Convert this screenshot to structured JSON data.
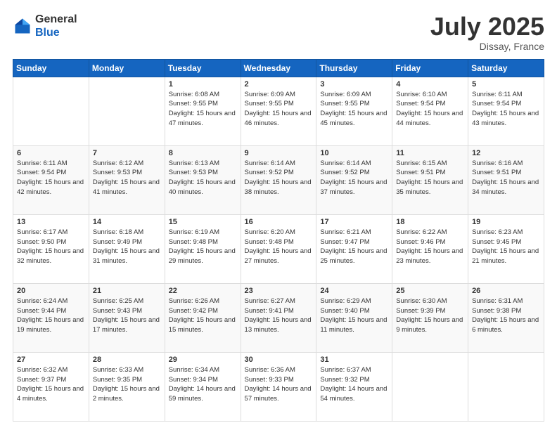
{
  "header": {
    "logo_general": "General",
    "logo_blue": "Blue",
    "month": "July 2025",
    "location": "Dissay, France"
  },
  "days_of_week": [
    "Sunday",
    "Monday",
    "Tuesday",
    "Wednesday",
    "Thursday",
    "Friday",
    "Saturday"
  ],
  "weeks": [
    [
      {
        "day": "",
        "info": ""
      },
      {
        "day": "",
        "info": ""
      },
      {
        "day": "1",
        "sunrise": "Sunrise: 6:08 AM",
        "sunset": "Sunset: 9:55 PM",
        "daylight": "Daylight: 15 hours and 47 minutes."
      },
      {
        "day": "2",
        "sunrise": "Sunrise: 6:09 AM",
        "sunset": "Sunset: 9:55 PM",
        "daylight": "Daylight: 15 hours and 46 minutes."
      },
      {
        "day": "3",
        "sunrise": "Sunrise: 6:09 AM",
        "sunset": "Sunset: 9:55 PM",
        "daylight": "Daylight: 15 hours and 45 minutes."
      },
      {
        "day": "4",
        "sunrise": "Sunrise: 6:10 AM",
        "sunset": "Sunset: 9:54 PM",
        "daylight": "Daylight: 15 hours and 44 minutes."
      },
      {
        "day": "5",
        "sunrise": "Sunrise: 6:11 AM",
        "sunset": "Sunset: 9:54 PM",
        "daylight": "Daylight: 15 hours and 43 minutes."
      }
    ],
    [
      {
        "day": "6",
        "sunrise": "Sunrise: 6:11 AM",
        "sunset": "Sunset: 9:54 PM",
        "daylight": "Daylight: 15 hours and 42 minutes."
      },
      {
        "day": "7",
        "sunrise": "Sunrise: 6:12 AM",
        "sunset": "Sunset: 9:53 PM",
        "daylight": "Daylight: 15 hours and 41 minutes."
      },
      {
        "day": "8",
        "sunrise": "Sunrise: 6:13 AM",
        "sunset": "Sunset: 9:53 PM",
        "daylight": "Daylight: 15 hours and 40 minutes."
      },
      {
        "day": "9",
        "sunrise": "Sunrise: 6:14 AM",
        "sunset": "Sunset: 9:52 PM",
        "daylight": "Daylight: 15 hours and 38 minutes."
      },
      {
        "day": "10",
        "sunrise": "Sunrise: 6:14 AM",
        "sunset": "Sunset: 9:52 PM",
        "daylight": "Daylight: 15 hours and 37 minutes."
      },
      {
        "day": "11",
        "sunrise": "Sunrise: 6:15 AM",
        "sunset": "Sunset: 9:51 PM",
        "daylight": "Daylight: 15 hours and 35 minutes."
      },
      {
        "day": "12",
        "sunrise": "Sunrise: 6:16 AM",
        "sunset": "Sunset: 9:51 PM",
        "daylight": "Daylight: 15 hours and 34 minutes."
      }
    ],
    [
      {
        "day": "13",
        "sunrise": "Sunrise: 6:17 AM",
        "sunset": "Sunset: 9:50 PM",
        "daylight": "Daylight: 15 hours and 32 minutes."
      },
      {
        "day": "14",
        "sunrise": "Sunrise: 6:18 AM",
        "sunset": "Sunset: 9:49 PM",
        "daylight": "Daylight: 15 hours and 31 minutes."
      },
      {
        "day": "15",
        "sunrise": "Sunrise: 6:19 AM",
        "sunset": "Sunset: 9:48 PM",
        "daylight": "Daylight: 15 hours and 29 minutes."
      },
      {
        "day": "16",
        "sunrise": "Sunrise: 6:20 AM",
        "sunset": "Sunset: 9:48 PM",
        "daylight": "Daylight: 15 hours and 27 minutes."
      },
      {
        "day": "17",
        "sunrise": "Sunrise: 6:21 AM",
        "sunset": "Sunset: 9:47 PM",
        "daylight": "Daylight: 15 hours and 25 minutes."
      },
      {
        "day": "18",
        "sunrise": "Sunrise: 6:22 AM",
        "sunset": "Sunset: 9:46 PM",
        "daylight": "Daylight: 15 hours and 23 minutes."
      },
      {
        "day": "19",
        "sunrise": "Sunrise: 6:23 AM",
        "sunset": "Sunset: 9:45 PM",
        "daylight": "Daylight: 15 hours and 21 minutes."
      }
    ],
    [
      {
        "day": "20",
        "sunrise": "Sunrise: 6:24 AM",
        "sunset": "Sunset: 9:44 PM",
        "daylight": "Daylight: 15 hours and 19 minutes."
      },
      {
        "day": "21",
        "sunrise": "Sunrise: 6:25 AM",
        "sunset": "Sunset: 9:43 PM",
        "daylight": "Daylight: 15 hours and 17 minutes."
      },
      {
        "day": "22",
        "sunrise": "Sunrise: 6:26 AM",
        "sunset": "Sunset: 9:42 PM",
        "daylight": "Daylight: 15 hours and 15 minutes."
      },
      {
        "day": "23",
        "sunrise": "Sunrise: 6:27 AM",
        "sunset": "Sunset: 9:41 PM",
        "daylight": "Daylight: 15 hours and 13 minutes."
      },
      {
        "day": "24",
        "sunrise": "Sunrise: 6:29 AM",
        "sunset": "Sunset: 9:40 PM",
        "daylight": "Daylight: 15 hours and 11 minutes."
      },
      {
        "day": "25",
        "sunrise": "Sunrise: 6:30 AM",
        "sunset": "Sunset: 9:39 PM",
        "daylight": "Daylight: 15 hours and 9 minutes."
      },
      {
        "day": "26",
        "sunrise": "Sunrise: 6:31 AM",
        "sunset": "Sunset: 9:38 PM",
        "daylight": "Daylight: 15 hours and 6 minutes."
      }
    ],
    [
      {
        "day": "27",
        "sunrise": "Sunrise: 6:32 AM",
        "sunset": "Sunset: 9:37 PM",
        "daylight": "Daylight: 15 hours and 4 minutes."
      },
      {
        "day": "28",
        "sunrise": "Sunrise: 6:33 AM",
        "sunset": "Sunset: 9:35 PM",
        "daylight": "Daylight: 15 hours and 2 minutes."
      },
      {
        "day": "29",
        "sunrise": "Sunrise: 6:34 AM",
        "sunset": "Sunset: 9:34 PM",
        "daylight": "Daylight: 14 hours and 59 minutes."
      },
      {
        "day": "30",
        "sunrise": "Sunrise: 6:36 AM",
        "sunset": "Sunset: 9:33 PM",
        "daylight": "Daylight: 14 hours and 57 minutes."
      },
      {
        "day": "31",
        "sunrise": "Sunrise: 6:37 AM",
        "sunset": "Sunset: 9:32 PM",
        "daylight": "Daylight: 14 hours and 54 minutes."
      },
      {
        "day": "",
        "info": ""
      },
      {
        "day": "",
        "info": ""
      }
    ]
  ]
}
